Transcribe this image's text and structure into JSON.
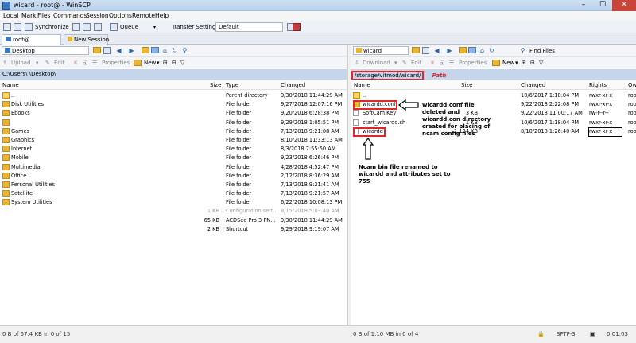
{
  "window": {
    "title": "wicard - root@        - WinSCP",
    "minimize": "–",
    "maximize": "☐",
    "close": "✕"
  },
  "menu": [
    "Local",
    "Mark",
    "Files",
    "Commands",
    "Session",
    "Options",
    "Remote",
    "Help"
  ],
  "toolbar": {
    "synchronize": "Synchronize",
    "queue": "Queue",
    "transfer_settings_label": "Transfer Settings",
    "transfer_settings_value": "Default"
  },
  "tabs": {
    "session": "root@",
    "new_session": "New Session"
  },
  "left": {
    "location": "Desktop",
    "actions": {
      "upload": "Upload",
      "edit": "Edit",
      "properties": "Properties",
      "new": "New"
    },
    "path": "C:\\Users\\         \\Desktop\\",
    "columns": {
      "name": "Name",
      "size": "Size",
      "type": "Type",
      "changed": "Changed"
    },
    "rows": [
      {
        "name": "..",
        "size": "",
        "type": "Parent directory",
        "changed": "9/30/2018 11:44:29 AM",
        "icon": "up"
      },
      {
        "name": "Disk Utilities",
        "size": "",
        "type": "File folder",
        "changed": "9/27/2018 12:07:16 PM",
        "icon": "folder"
      },
      {
        "name": "Ebooks",
        "size": "",
        "type": "File folder",
        "changed": "9/20/2018 6:28:38 PM",
        "icon": "folder"
      },
      {
        "name": "",
        "size": "",
        "type": "File folder",
        "changed": "9/29/2018 1:05:51 PM",
        "icon": "folder"
      },
      {
        "name": "Games",
        "size": "",
        "type": "File folder",
        "changed": "7/13/2018 9:21:08 AM",
        "icon": "folder"
      },
      {
        "name": "Graphics",
        "size": "",
        "type": "File folder",
        "changed": "8/10/2018 11:33:13 AM",
        "icon": "folder"
      },
      {
        "name": "Internet",
        "size": "",
        "type": "File folder",
        "changed": "8/3/2018 7:55:50 AM",
        "icon": "folder"
      },
      {
        "name": "Mobile",
        "size": "",
        "type": "File folder",
        "changed": "9/23/2018 6:26:46 PM",
        "icon": "folder"
      },
      {
        "name": "Multimedia",
        "size": "",
        "type": "File folder",
        "changed": "4/28/2018 4:52:47 PM",
        "icon": "folder"
      },
      {
        "name": "Office",
        "size": "",
        "type": "File folder",
        "changed": "2/12/2018 8:36:29 AM",
        "icon": "folder"
      },
      {
        "name": "Personal Utilities",
        "size": "",
        "type": "File folder",
        "changed": "7/13/2018 9:21:41 AM",
        "icon": "folder"
      },
      {
        "name": "Satellite",
        "size": "",
        "type": "File folder",
        "changed": "7/13/2018 9:21:57 AM",
        "icon": "folder"
      },
      {
        "name": "System Utilities",
        "size": "",
        "type": "File folder",
        "changed": "6/22/2018 10:08:13 PM",
        "icon": "folder"
      },
      {
        "name": "",
        "size": "1 KB",
        "type": "Configuration sett...",
        "changed": "8/15/2018 5:03:40 AM",
        "icon": "none",
        "muted": true
      },
      {
        "name": "",
        "size": "65 KB",
        "type": "ACDSee Pro 3 PN...",
        "changed": "9/30/2018 11:44:29 AM",
        "icon": "none"
      },
      {
        "name": "",
        "size": "2 KB",
        "type": "Shortcut",
        "changed": "9/29/2018 9:19:07 AM",
        "icon": "none"
      }
    ],
    "status": "0 B of 57.4 KB in 0 of 15"
  },
  "right": {
    "location": "wicard",
    "find_files": "Find Files",
    "actions": {
      "download": "Download",
      "edit": "Edit",
      "properties": "Properties",
      "new": "New"
    },
    "path": "/storage/vitmod/wicard/",
    "path_annotation": "Path",
    "columns": {
      "name": "Name",
      "size": "Size",
      "changed": "Changed",
      "rights": "Rights",
      "owner": "Ow"
    },
    "rows": [
      {
        "name": "..",
        "size": "",
        "changed": "10/6/2017 1:18:04 PM",
        "rights": "rwxr-xr-x",
        "owner": "roo",
        "icon": "up"
      },
      {
        "name": "wicardd.conf",
        "size": "",
        "changed": "9/22/2018 2:22:08 PM",
        "rights": "rwxr-xr-x",
        "owner": "roo",
        "icon": "folder"
      },
      {
        "name": "SoftCam.Key",
        "size": "3 KB",
        "changed": "9/22/2018 11:00:17 AM",
        "rights": "rw-r--r--",
        "owner": "roo",
        "icon": "file"
      },
      {
        "name": "start_wicardd.sh",
        "size": "1 KB",
        "changed": "10/6/2017 1:18:04 PM",
        "rights": "rwxr-xr-x",
        "owner": "roo",
        "icon": "file"
      },
      {
        "name": "wicardd",
        "size": "1,134 KB",
        "changed": "8/10/2018 1:26:40 AM",
        "rights": "rwxr-xr-x",
        "owner": "roo",
        "icon": "file"
      }
    ],
    "status": "0 B of 1.10 MB in 0 of 4"
  },
  "annotations": {
    "conf_lines": [
      "wicardd.conf file",
      "deleted and",
      "wicardd.con directory",
      "created for placing of",
      "ncam config files"
    ],
    "bin_lines": [
      "Ncam bin file renamed to",
      "wicardd and attributes set to",
      "755"
    ]
  },
  "status": {
    "protocol": "SFTP-3",
    "time": "0:01:03"
  },
  "colors": {
    "annotation_red": "#e2242b",
    "path_bar": "#c5d6ec",
    "title_bar": "#b9d1ea"
  }
}
